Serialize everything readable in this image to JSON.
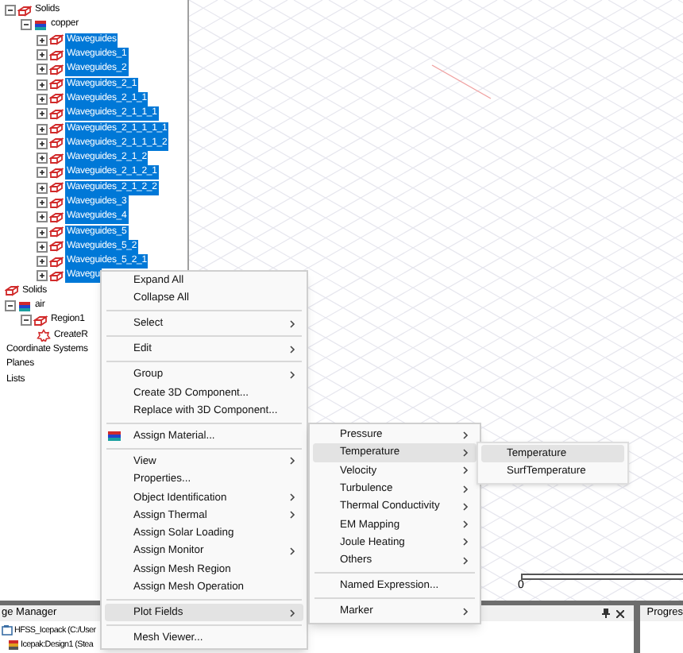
{
  "tree": [
    {
      "label": "Solids",
      "kind": "solid",
      "expanded": true,
      "children": [
        {
          "label": "copper",
          "kind": "material",
          "expanded": true,
          "children": [
            {
              "label": "Waveguides",
              "kind": "solid",
              "expanded": false,
              "selected": true
            },
            {
              "label": "Waveguides_1",
              "kind": "solid",
              "expanded": false,
              "selected": true
            },
            {
              "label": "Waveguides_2",
              "kind": "solid",
              "expanded": false,
              "selected": true
            },
            {
              "label": "Waveguides_2_1",
              "kind": "solid",
              "expanded": false,
              "selected": true
            },
            {
              "label": "Waveguides_2_1_1",
              "kind": "solid",
              "expanded": false,
              "selected": true
            },
            {
              "label": "Waveguides_2_1_1_1",
              "kind": "solid",
              "expanded": false,
              "selected": true
            },
            {
              "label": "Waveguides_2_1_1_1_1",
              "kind": "solid",
              "expanded": false,
              "selected": true
            },
            {
              "label": "Waveguides_2_1_1_1_2",
              "kind": "solid",
              "expanded": false,
              "selected": true
            },
            {
              "label": "Waveguides_2_1_2",
              "kind": "solid",
              "expanded": false,
              "selected": true
            },
            {
              "label": "Waveguides_2_1_2_1",
              "kind": "solid",
              "expanded": false,
              "selected": true
            },
            {
              "label": "Waveguides_2_1_2_2",
              "kind": "solid",
              "expanded": false,
              "selected": true
            },
            {
              "label": "Waveguides_3",
              "kind": "solid",
              "expanded": false,
              "selected": true
            },
            {
              "label": "Waveguides_4",
              "kind": "solid",
              "expanded": false,
              "selected": true
            },
            {
              "label": "Waveguides_5",
              "kind": "solid",
              "expanded": false,
              "selected": true
            },
            {
              "label": "Waveguides_5_2",
              "kind": "solid",
              "expanded": false,
              "selected": true
            },
            {
              "label": "Waveguides_5_2_1",
              "kind": "solid",
              "expanded": false,
              "selected": true
            },
            {
              "label": "Wavegu",
              "kind": "solid",
              "expanded": false,
              "selected": true
            }
          ]
        }
      ]
    },
    {
      "label": "Solids",
      "kind": "solid"
    },
    {
      "label": "air",
      "kind": "material",
      "expanded": true,
      "children": [
        {
          "label": "Region1",
          "kind": "solid",
          "expanded": true,
          "children": [
            {
              "label": "CreateR",
              "kind": "operation"
            }
          ]
        }
      ]
    },
    {
      "label": "Coordinate Systems",
      "kind": "plain"
    },
    {
      "label": "Planes",
      "kind": "plain"
    },
    {
      "label": "Lists",
      "kind": "plain"
    }
  ],
  "viewport": {
    "scale_label": "0"
  },
  "bottom_panel": {
    "title": "ge Manager",
    "items": [
      {
        "label": "HFSS_Icepack (C:/User",
        "kind": "project"
      },
      {
        "label": "Icepak:Design1 (Stea",
        "kind": "design"
      }
    ]
  },
  "progress_panel": {
    "title": "Progres"
  },
  "context_menu": {
    "items": [
      {
        "kind": "item",
        "label": "Expand All",
        "submenu": false,
        "selected": false
      },
      {
        "kind": "item",
        "label": "Collapse All",
        "submenu": false,
        "selected": false
      },
      {
        "kind": "separator"
      },
      {
        "kind": "item",
        "label": "Select",
        "submenu": true,
        "selected": false
      },
      {
        "kind": "separator"
      },
      {
        "kind": "item",
        "label": "Edit",
        "submenu": true,
        "selected": false
      },
      {
        "kind": "separator"
      },
      {
        "kind": "item",
        "label": "Group",
        "submenu": true,
        "selected": false
      },
      {
        "kind": "item",
        "label": "Create 3D Component...",
        "submenu": false,
        "selected": false
      },
      {
        "kind": "item",
        "label": "Replace with 3D Component...",
        "submenu": false,
        "selected": false
      },
      {
        "kind": "separator"
      },
      {
        "kind": "icon-item",
        "label": "Assign Material...",
        "submenu": false,
        "selected": false
      },
      {
        "kind": "separator"
      },
      {
        "kind": "item",
        "label": "View",
        "submenu": true,
        "selected": false
      },
      {
        "kind": "item",
        "label": "Properties...",
        "submenu": false,
        "selected": false
      },
      {
        "kind": "item",
        "label": "Object Identification",
        "submenu": true,
        "selected": false
      },
      {
        "kind": "item",
        "label": "Assign Thermal",
        "submenu": true,
        "selected": false
      },
      {
        "kind": "item",
        "label": "Assign Solar Loading",
        "submenu": false,
        "selected": false
      },
      {
        "kind": "item",
        "label": "Assign Monitor",
        "submenu": true,
        "selected": false
      },
      {
        "kind": "item",
        "label": "Assign Mesh Region",
        "submenu": false,
        "selected": false
      },
      {
        "kind": "item",
        "label": "Assign Mesh Operation",
        "submenu": false,
        "selected": false
      },
      {
        "kind": "separator"
      },
      {
        "kind": "item",
        "label": "Plot Fields",
        "submenu": true,
        "selected": true
      },
      {
        "kind": "separator"
      },
      {
        "kind": "item",
        "label": "Mesh Viewer...",
        "submenu": false,
        "selected": false
      }
    ]
  },
  "submenu": {
    "items": [
      {
        "kind": "item",
        "label": "Pressure",
        "submenu": true,
        "selected": false
      },
      {
        "kind": "item",
        "label": "Temperature",
        "submenu": true,
        "selected": true
      },
      {
        "kind": "item",
        "label": "Velocity",
        "submenu": true,
        "selected": false
      },
      {
        "kind": "item",
        "label": "Turbulence",
        "submenu": true,
        "selected": false
      },
      {
        "kind": "item",
        "label": "Thermal Conductivity",
        "submenu": true,
        "selected": false
      },
      {
        "kind": "item",
        "label": "EM Mapping",
        "submenu": true,
        "selected": false
      },
      {
        "kind": "item",
        "label": "Joule Heating",
        "submenu": true,
        "selected": false
      },
      {
        "kind": "item",
        "label": "Others",
        "submenu": true,
        "selected": false
      },
      {
        "kind": "separator"
      },
      {
        "kind": "item",
        "label": "Named Expression...",
        "submenu": false,
        "selected": false
      },
      {
        "kind": "separator"
      },
      {
        "kind": "item",
        "label": "Marker",
        "submenu": true,
        "selected": false
      }
    ]
  },
  "submenu_2": {
    "items": [
      {
        "kind": "item",
        "label": "Temperature",
        "submenu": false,
        "selected": true
      },
      {
        "kind": "item",
        "label": "SurfTemperature",
        "submenu": false,
        "selected": false
      }
    ]
  }
}
